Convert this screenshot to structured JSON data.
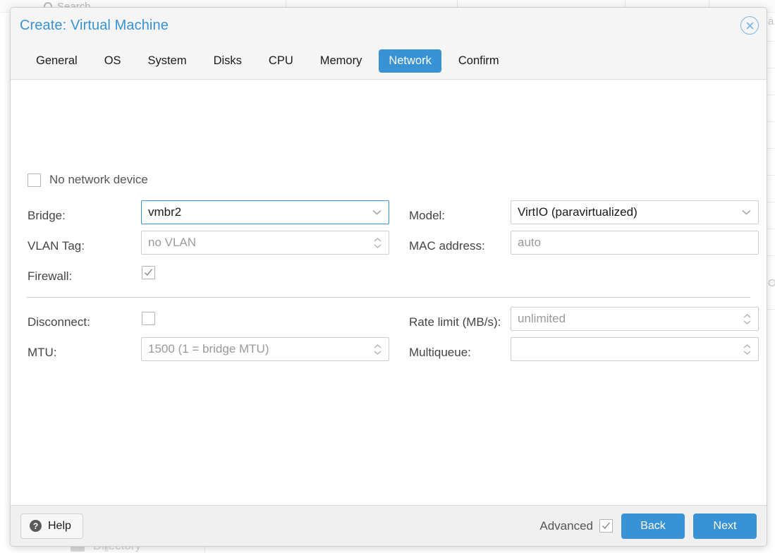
{
  "background": {
    "search_placeholder": "Search",
    "right_fragment_1": "a",
    "right_fragment_2": "Ot",
    "directory_label": "Directory"
  },
  "dialog": {
    "title": "Create: Virtual Machine",
    "close_icon": "close-circle-icon",
    "tabs": [
      {
        "label": "General",
        "active": false
      },
      {
        "label": "OS",
        "active": false
      },
      {
        "label": "System",
        "active": false
      },
      {
        "label": "Disks",
        "active": false
      },
      {
        "label": "CPU",
        "active": false
      },
      {
        "label": "Memory",
        "active": false
      },
      {
        "label": "Network",
        "active": true
      },
      {
        "label": "Confirm",
        "active": false
      }
    ],
    "accent_color": "#3892d4",
    "no_network_device": {
      "label": "No network device",
      "checked": false
    },
    "fields": {
      "bridge": {
        "label": "Bridge:",
        "value": "vmbr2",
        "placeholder": "",
        "type": "combobox",
        "focused": true
      },
      "vlan_tag": {
        "label": "VLAN Tag:",
        "value": "",
        "placeholder": "no VLAN",
        "type": "spinner",
        "focused": false
      },
      "firewall": {
        "label": "Firewall:",
        "checked": true
      },
      "model": {
        "label": "Model:",
        "value": "VirtIO (paravirtualized)",
        "placeholder": "",
        "type": "combobox",
        "focused": false
      },
      "mac_address": {
        "label": "MAC address:",
        "value": "",
        "placeholder": "auto",
        "type": "text",
        "focused": false
      },
      "disconnect": {
        "label": "Disconnect:",
        "checked": false
      },
      "mtu": {
        "label": "MTU:",
        "value": "",
        "placeholder": "1500 (1 = bridge MTU)",
        "type": "spinner",
        "focused": false
      },
      "rate_limit": {
        "label": "Rate limit (MB/s):",
        "value": "",
        "placeholder": "unlimited",
        "type": "spinner",
        "focused": false
      },
      "multiqueue": {
        "label": "Multiqueue:",
        "value": "",
        "placeholder": "",
        "type": "spinner",
        "focused": false
      }
    },
    "footer": {
      "help_label": "Help",
      "help_icon": "question-mark-icon",
      "advanced_label": "Advanced",
      "advanced_checked": true,
      "back_label": "Back",
      "next_label": "Next"
    }
  }
}
